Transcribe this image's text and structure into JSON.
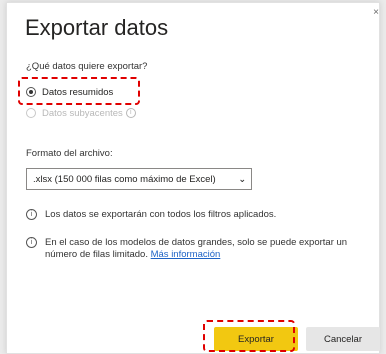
{
  "dialog": {
    "title": "Exportar datos",
    "close_glyph": "×",
    "question": "¿Qué datos quiere exportar?",
    "options": [
      {
        "label": "Datos resumidos",
        "selected": true,
        "enabled": true
      },
      {
        "label": "Datos subyacentes",
        "selected": false,
        "enabled": false,
        "icon": "info-icon"
      }
    ],
    "format_label": "Formato del archivo:",
    "format_select": {
      "value": ".xlsx (150 000 filas como máximo de Excel)"
    },
    "notes": [
      {
        "icon": "info-icon",
        "text": "Los datos se exportarán con todos los filtros aplicados."
      },
      {
        "icon": "info-icon",
        "text": "En el caso de los modelos de datos grandes, solo se puede exportar un número de filas limitado.",
        "link": "Más información"
      }
    ],
    "buttons": {
      "export": "Exportar",
      "cancel": "Cancelar"
    }
  },
  "colors": {
    "accent": "#f2c811",
    "highlight": "#e00000",
    "link": "#1e63c6"
  }
}
